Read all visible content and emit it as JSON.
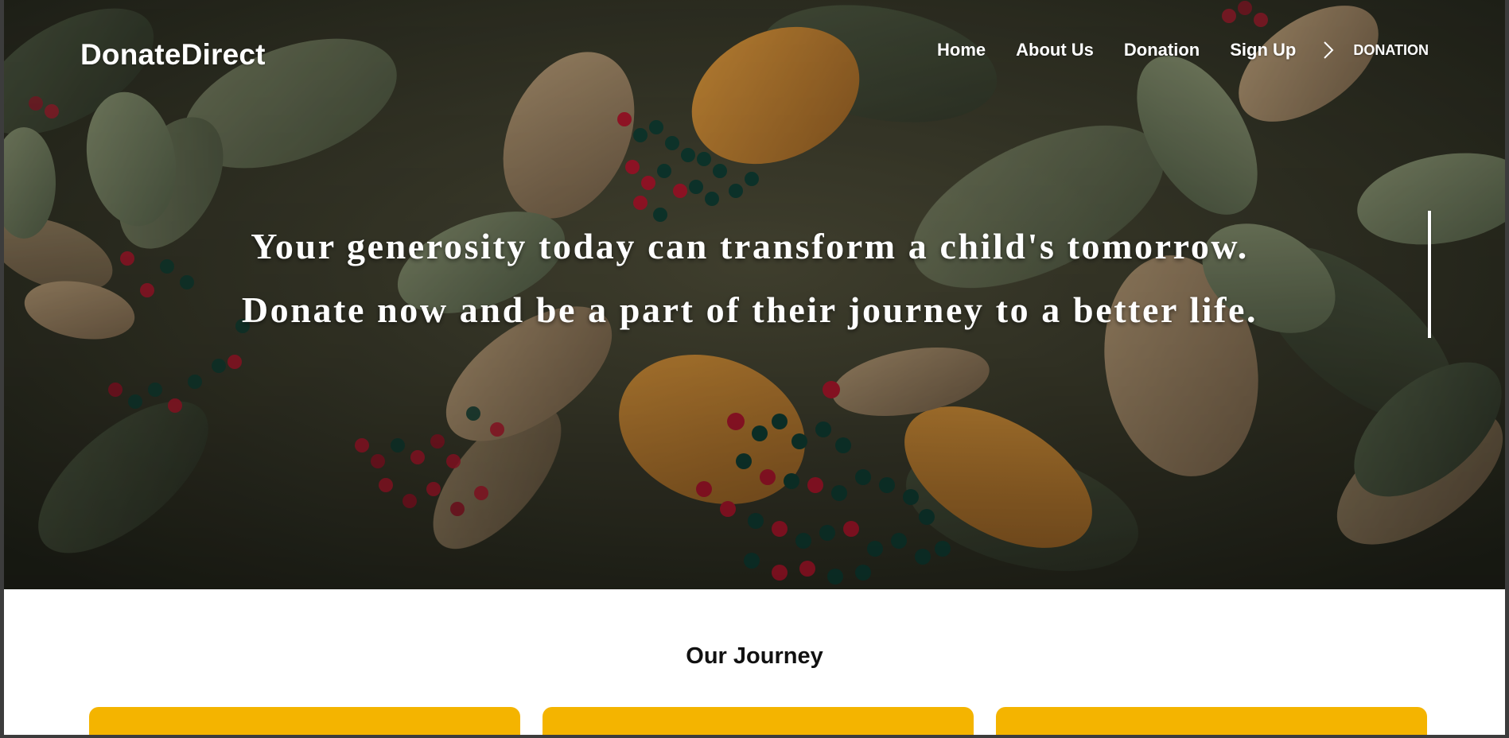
{
  "brand": {
    "name": "DonateDirect"
  },
  "nav": {
    "links": [
      "Home",
      "About Us",
      "Donation",
      "Sign Up"
    ],
    "chevron_icon": "chevron-right-icon",
    "cta_label": "DONATION"
  },
  "hero": {
    "line1": "Your generosity today can transform a child's tomorrow.",
    "line2": "Donate now and be a part of their journey to a better life.",
    "background": "photo of green leaves with red and dark green berries"
  },
  "journey": {
    "title": "Our Journey",
    "cards": [
      "",
      "",
      ""
    ]
  },
  "colors": {
    "card_accent": "#f4b400",
    "hero_text": "#ffffff",
    "page_bg": "#ffffff"
  }
}
